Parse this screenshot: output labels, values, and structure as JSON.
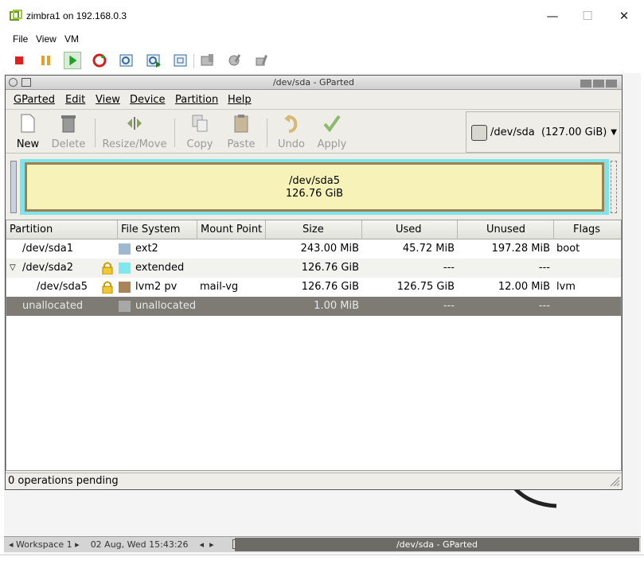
{
  "host": {
    "title": "zimbra1 on 192.168.0.3",
    "menu": [
      "File",
      "View",
      "VM"
    ],
    "toolbar_icons": [
      "stop-icon",
      "pause-icon",
      "play-icon",
      "reset-icon",
      "snapshot-icon",
      "snapshot-restore-icon",
      "snapshot-manager-icon",
      "vm-settings-icon",
      "vm-edit-icon",
      "vm-tools-icon"
    ],
    "window_controls": {
      "minimize": "—",
      "maximize": "☐",
      "close": "✕"
    }
  },
  "gparted": {
    "window_title": "/dev/sda - GParted",
    "menu": [
      "GParted",
      "Edit",
      "View",
      "Device",
      "Partition",
      "Help"
    ],
    "toolbar": {
      "new": "New",
      "delete": "Delete",
      "resize_move": "Resize/Move",
      "copy": "Copy",
      "paste": "Paste",
      "undo": "Undo",
      "apply": "Apply"
    },
    "device": {
      "name": "/dev/sda",
      "size": "(127.00 GiB)"
    },
    "graph": {
      "name": "/dev/sda5",
      "size": "126.76 GiB"
    },
    "columns": [
      "Partition",
      "File System",
      "Mount Point",
      "Size",
      "Used",
      "Unused",
      "Flags"
    ],
    "rows": [
      {
        "partition": "/dev/sda1",
        "fs": "ext2",
        "fs_color": "#9eb8d4",
        "mount": "",
        "size": "243.00 MiB",
        "used": "45.72 MiB",
        "unused": "197.28 MiB",
        "flags": "boot",
        "locked": false
      },
      {
        "partition": "/dev/sda2",
        "fs": "extended",
        "fs_color": "#7fe8ee",
        "mount": "",
        "size": "126.76 GiB",
        "used": "---",
        "unused": "---",
        "flags": "",
        "locked": true
      },
      {
        "partition": "/dev/sda5",
        "fs": "lvm2 pv",
        "fs_color": "#a88456",
        "mount": "mail-vg",
        "size": "126.76 GiB",
        "used": "126.75 GiB",
        "unused": "12.00 MiB",
        "flags": "lvm",
        "locked": true
      },
      {
        "partition": "unallocated",
        "fs": "unallocated",
        "fs_color": "#a8a8a8",
        "mount": "",
        "size": "1.00 MiB",
        "used": "---",
        "unused": "---",
        "flags": "",
        "locked": false
      }
    ],
    "status": "0 operations pending"
  },
  "taskbar": {
    "workspace": "Workspace 1",
    "datetime": "02 Aug, Wed 15:43:26",
    "task": "/dev/sda - GParted"
  }
}
